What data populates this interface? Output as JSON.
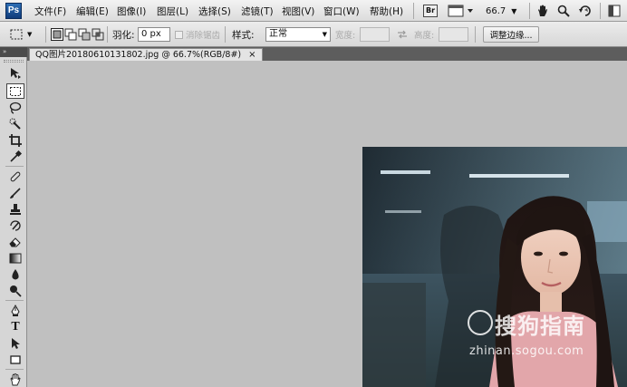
{
  "app": {
    "logo": "Ps"
  },
  "menu": [
    "文件(F)",
    "编辑(E)",
    "图像(I)",
    "图层(L)",
    "选择(S)",
    "滤镜(T)",
    "视图(V)",
    "窗口(W)",
    "帮助(H)"
  ],
  "menubar": {
    "br_label": "Br",
    "zoom": "66.7",
    "icons": [
      "bridge-icon",
      "screen-mode-icon",
      "hand-icon",
      "zoom-icon",
      "rotate-view-icon",
      "arrange-documents-icon"
    ]
  },
  "options": {
    "feather_label": "羽化:",
    "feather_value": "0 px",
    "antialias_label": "消除锯齿",
    "style_label": "样式:",
    "style_value": "正常",
    "width_label": "宽度:",
    "height_label": "高度:",
    "refine_edge_label": "调整边缘..."
  },
  "document": {
    "tab_title": "QQ图片20180610131802.jpg @ 66.7%(RGB/8#)",
    "close_glyph": "×"
  },
  "toolbar": {
    "header_glyph": "»",
    "tools": [
      "move-tool",
      "rectangular-marquee-tool",
      "lasso-tool",
      "quick-selection-tool",
      "crop-tool",
      "eyedropper-tool",
      "spot-healing-brush-tool",
      "brush-tool",
      "clone-stamp-tool",
      "history-brush-tool",
      "eraser-tool",
      "gradient-tool",
      "blur-tool",
      "dodge-tool",
      "pen-tool",
      "type-tool",
      "path-selection-tool",
      "rectangle-tool",
      "hand-tool"
    ],
    "type_glyph": "T"
  },
  "watermark": {
    "brand": "搜狗指南",
    "url": "zhinan.sogou.com"
  },
  "colors": {
    "canvas": "#c0c0c0",
    "accent": "#2e6fb6"
  }
}
